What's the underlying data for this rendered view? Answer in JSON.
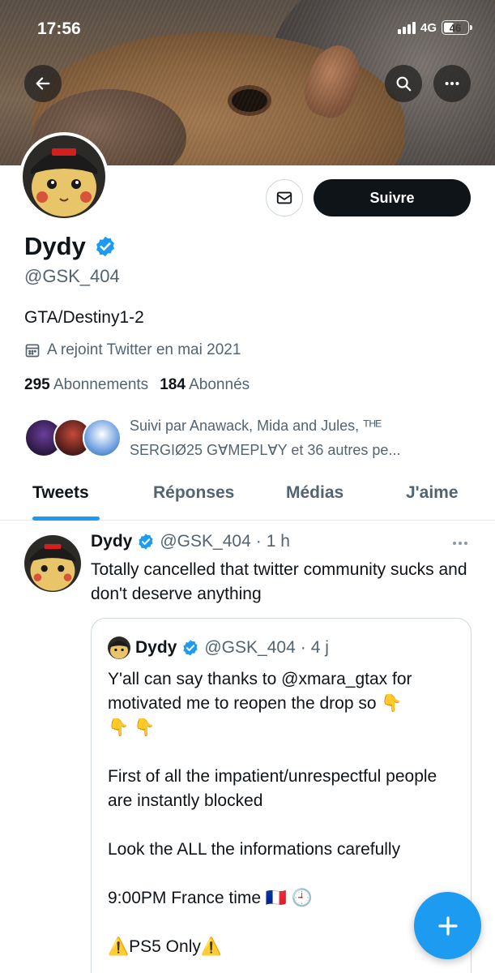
{
  "status_bar": {
    "time": "17:56",
    "network": "4G",
    "battery": "46",
    "battery_fraction": 0.46
  },
  "header_icons": {
    "back": "arrow-left-icon",
    "search": "search-icon",
    "more": "more-horizontal-icon"
  },
  "profile": {
    "name": "Dydy",
    "verified": true,
    "handle": "@GSK_404",
    "bio": "GTA/Destiny1-2",
    "joined": "A rejoint Twitter en mai 2021",
    "following_count": "295",
    "following_label": "Abonnements",
    "followers_count": "184",
    "followers_label": "Abonnés",
    "followed_by": "Suivi par Anawack, Mida and Jules, ᵀᴴᴱ SERGIØ25 GⱯMEPLⱯY et 36 autres pe...",
    "follow_label": "Suivre"
  },
  "tabs": [
    {
      "label": "Tweets",
      "active": true
    },
    {
      "label": "Réponses",
      "active": false
    },
    {
      "label": "Médias",
      "active": false
    },
    {
      "label": "J'aime",
      "active": false
    }
  ],
  "tweet": {
    "name": "Dydy",
    "handle": "@GSK_404",
    "separator": "·",
    "time": "1 h",
    "text": "Totally cancelled that twitter community sucks and don't deserve anything",
    "quote": {
      "name": "Dydy",
      "handle": "@GSK_404",
      "separator": "·",
      "time": "4 j",
      "text": "Y'all can say thanks to @xmara_gtax for motivated me to reopen the drop so 👇\n👇 👇\n\nFirst of all the impatient/unrespectful people are instantly blocked\n\nLook the ALL the informations carefully\n\n9:00PM France time 🇫🇷 🕘\n\n⚠️PS5 Only⚠️"
    }
  },
  "colors": {
    "accent": "#1d9bf0",
    "text": "#0f1419",
    "muted": "#536471",
    "border": "#cfd9de"
  }
}
